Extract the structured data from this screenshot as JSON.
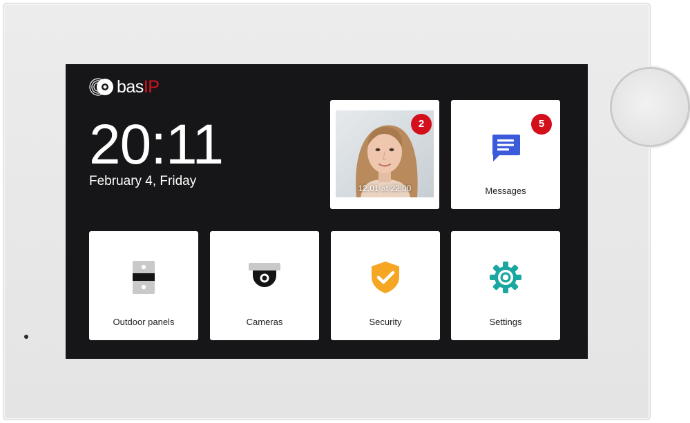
{
  "brand": {
    "logo_name": "bas-ip-logo",
    "text_bas": "bas",
    "text_ip": "IP",
    "accent_color": "#d7131f"
  },
  "clock": {
    "time": "20:11",
    "date": "February 4, Friday"
  },
  "tiles": {
    "last_call": {
      "caption": "12.01 at 22:00",
      "badge": "2"
    },
    "messages": {
      "label": "Messages",
      "badge": "5",
      "icon": "message-icon",
      "icon_color": "#3b5bdb"
    },
    "outdoor_panels": {
      "label": "Outdoor panels",
      "icon": "outdoor-panel-icon"
    },
    "cameras": {
      "label": "Cameras",
      "icon": "camera-icon"
    },
    "security": {
      "label": "Security",
      "icon": "shield-icon",
      "icon_color": "#f5a623"
    },
    "settings": {
      "label": "Settings",
      "icon": "gear-icon",
      "icon_color": "#1aa7a0"
    }
  },
  "colors": {
    "screen_bg": "#161618",
    "tile_bg": "#ffffff",
    "badge_bg": "#d30f1c",
    "device_frame": "#e8e8e8"
  }
}
